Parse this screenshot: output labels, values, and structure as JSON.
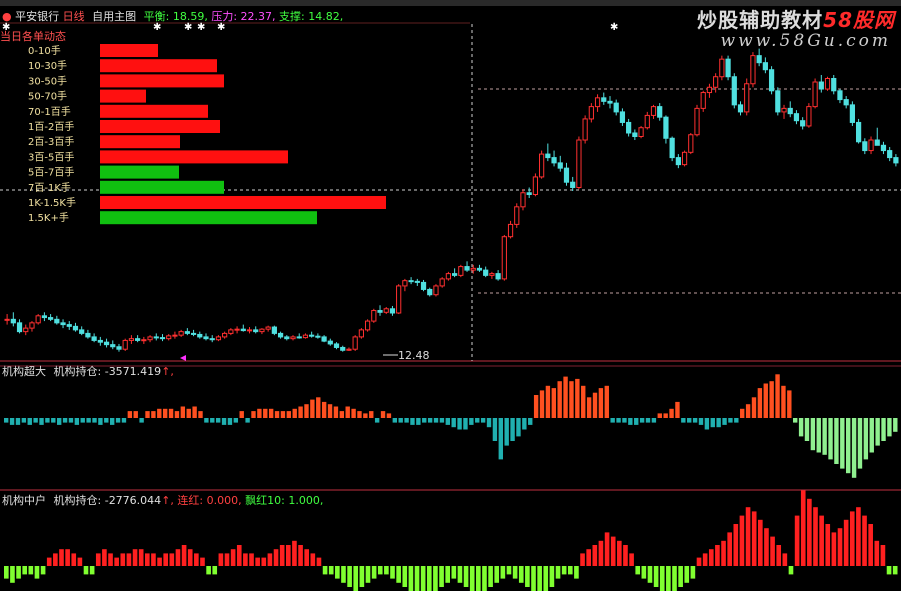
{
  "header": {
    "stock": "平安银行",
    "period": "日线",
    "main_chart": "自用主图",
    "balance_label": "平衡:",
    "balance_value": "18.59,",
    "pressure_label": "压力:",
    "pressure_value": "22.37,",
    "support_label": "支撑:",
    "support_value": "14.82,"
  },
  "watermark": {
    "brand": "炒股辅助教材",
    "brand_accent": "58股网",
    "url": "www.58Gu.com"
  },
  "price_label": "12.48",
  "colors": {
    "up": "#ff3030",
    "down": "#50e0e0",
    "bar_red": "#ff1010",
    "bar_green": "#10c010",
    "indicator_up": "#ff5020",
    "indicator_down": "#20b0b0",
    "indicator_down2": "#90f090",
    "lime": "#80ff30"
  },
  "order_panel": {
    "title": "当日各单动态",
    "rows": [
      {
        "label": "0-10手",
        "value": 58,
        "color": "red"
      },
      {
        "label": "10-30手",
        "value": 117,
        "color": "red"
      },
      {
        "label": "30-50手",
        "value": 124,
        "color": "red"
      },
      {
        "label": "50-70手",
        "value": 46,
        "color": "red"
      },
      {
        "label": "70-1百手",
        "value": 108,
        "color": "red"
      },
      {
        "label": "1百-2百手",
        "value": 120,
        "color": "red"
      },
      {
        "label": "2百-3百手",
        "value": 80,
        "color": "red"
      },
      {
        "label": "3百-5百手",
        "value": 188,
        "color": "red"
      },
      {
        "label": "5百-7百手",
        "value": 79,
        "color": "green"
      },
      {
        "label": "7百-1K手",
        "value": 124,
        "color": "green"
      },
      {
        "label": "1K-1.5K手",
        "value": 286,
        "color": "red"
      },
      {
        "label": "1.5K+手",
        "value": 217,
        "color": "green"
      }
    ]
  },
  "indicator1": {
    "name": "机构超大",
    "field": "机构持仓:",
    "value": "-3571.419",
    "arrow": "↑,"
  },
  "indicator2": {
    "name": "机构中户",
    "field": "机构持仓:",
    "value": "-2776.044",
    "arrow": "↑,",
    "extra1_label": "连红:",
    "extra1_value": "0.000,",
    "extra2_label": "飘红10:",
    "extra2_value": "1.000,"
  },
  "chart_data": {
    "type": "candlestick",
    "candles": [
      [
        13.4,
        13.55,
        13.25,
        13.4
      ],
      [
        13.4,
        13.6,
        13.2,
        13.3
      ],
      [
        13.3,
        13.4,
        13.0,
        13.05
      ],
      [
        13.05,
        13.25,
        12.95,
        13.15
      ],
      [
        13.15,
        13.35,
        13.05,
        13.3
      ],
      [
        13.3,
        13.55,
        13.25,
        13.5
      ],
      [
        13.5,
        13.6,
        13.35,
        13.45
      ],
      [
        13.45,
        13.55,
        13.35,
        13.4
      ],
      [
        13.4,
        13.5,
        13.25,
        13.3
      ],
      [
        13.3,
        13.4,
        13.15,
        13.25
      ],
      [
        13.25,
        13.35,
        13.1,
        13.2
      ],
      [
        13.2,
        13.3,
        13.05,
        13.1
      ],
      [
        13.1,
        13.2,
        12.95,
        13.0
      ],
      [
        13.0,
        13.1,
        12.85,
        12.9
      ],
      [
        12.9,
        13.0,
        12.75,
        12.8
      ],
      [
        12.8,
        12.9,
        12.65,
        12.75
      ],
      [
        12.75,
        12.85,
        12.6,
        12.68
      ],
      [
        12.68,
        12.8,
        12.55,
        12.62
      ],
      [
        12.62,
        12.7,
        12.48,
        12.55
      ],
      [
        12.55,
        12.85,
        12.5,
        12.8
      ],
      [
        12.8,
        12.95,
        12.7,
        12.85
      ],
      [
        12.85,
        12.95,
        12.75,
        12.8
      ],
      [
        12.8,
        12.9,
        12.7,
        12.82
      ],
      [
        12.82,
        12.95,
        12.75,
        12.9
      ],
      [
        12.9,
        13.0,
        12.8,
        12.88
      ],
      [
        12.88,
        12.98,
        12.78,
        12.85
      ],
      [
        12.85,
        12.98,
        12.8,
        12.93
      ],
      [
        12.93,
        13.05,
        12.85,
        12.95
      ],
      [
        12.95,
        13.1,
        12.9,
        13.05
      ],
      [
        13.05,
        13.15,
        12.95,
        13.0
      ],
      [
        13.0,
        13.1,
        12.92,
        12.97
      ],
      [
        12.97,
        13.05,
        12.85,
        12.9
      ],
      [
        12.9,
        13.0,
        12.8,
        12.85
      ],
      [
        12.85,
        12.95,
        12.75,
        12.82
      ],
      [
        12.82,
        12.95,
        12.78,
        12.9
      ],
      [
        12.9,
        13.05,
        12.85,
        13.0
      ],
      [
        13.0,
        13.15,
        12.95,
        13.1
      ],
      [
        13.1,
        13.2,
        13.0,
        13.12
      ],
      [
        13.12,
        13.25,
        13.05,
        13.08
      ],
      [
        13.08,
        13.18,
        13.0,
        13.1
      ],
      [
        13.1,
        13.2,
        13.0,
        13.05
      ],
      [
        13.05,
        13.15,
        12.98,
        13.12
      ],
      [
        13.12,
        13.22,
        13.05,
        13.18
      ],
      [
        13.18,
        13.22,
        12.95,
        13.0
      ],
      [
        13.0,
        13.05,
        12.85,
        12.9
      ],
      [
        12.9,
        12.95,
        12.8,
        12.85
      ],
      [
        12.85,
        12.95,
        12.8,
        12.9
      ],
      [
        12.9,
        13.0,
        12.85,
        12.88
      ],
      [
        12.88,
        13.0,
        12.85,
        12.95
      ],
      [
        12.95,
        13.05,
        12.88,
        12.92
      ],
      [
        12.92,
        13.0,
        12.85,
        12.9
      ],
      [
        12.9,
        12.95,
        12.75,
        12.78
      ],
      [
        12.78,
        12.85,
        12.65,
        12.7
      ],
      [
        12.7,
        12.75,
        12.55,
        12.6
      ],
      [
        12.6,
        12.65,
        12.48,
        12.52
      ],
      [
        12.52,
        12.6,
        12.5,
        12.55
      ],
      [
        12.55,
        12.95,
        12.5,
        12.9
      ],
      [
        12.9,
        13.15,
        12.85,
        13.1
      ],
      [
        13.1,
        13.4,
        13.05,
        13.35
      ],
      [
        13.35,
        13.7,
        13.3,
        13.65
      ],
      [
        13.65,
        13.8,
        13.5,
        13.6
      ],
      [
        13.6,
        13.75,
        13.55,
        13.7
      ],
      [
        13.7,
        13.78,
        13.5,
        13.58
      ],
      [
        13.58,
        14.4,
        13.55,
        14.35
      ],
      [
        14.35,
        14.55,
        14.2,
        14.5
      ],
      [
        14.5,
        14.6,
        14.4,
        14.48
      ],
      [
        14.48,
        14.55,
        14.35,
        14.45
      ],
      [
        14.45,
        14.52,
        14.2,
        14.25
      ],
      [
        14.25,
        14.3,
        14.05,
        14.1
      ],
      [
        14.1,
        14.4,
        14.05,
        14.35
      ],
      [
        14.35,
        14.6,
        14.3,
        14.55
      ],
      [
        14.55,
        14.75,
        14.5,
        14.7
      ],
      [
        14.7,
        14.85,
        14.6,
        14.65
      ],
      [
        14.65,
        14.95,
        14.6,
        14.9
      ],
      [
        14.9,
        15.05,
        14.75,
        14.8
      ],
      [
        14.8,
        14.95,
        14.7,
        14.85
      ],
      [
        14.85,
        14.95,
        14.75,
        14.8
      ],
      [
        14.8,
        14.9,
        14.6,
        14.65
      ],
      [
        14.65,
        14.75,
        14.55,
        14.7
      ],
      [
        14.7,
        14.8,
        14.5,
        14.55
      ],
      [
        14.55,
        15.8,
        14.5,
        15.75
      ],
      [
        15.75,
        16.2,
        15.7,
        16.1
      ],
      [
        16.1,
        16.7,
        16.0,
        16.6
      ],
      [
        16.6,
        17.1,
        16.5,
        17.0
      ],
      [
        17.0,
        17.15,
        16.85,
        16.95
      ],
      [
        16.95,
        17.55,
        16.9,
        17.45
      ],
      [
        17.45,
        18.2,
        17.4,
        18.1
      ],
      [
        18.1,
        18.4,
        17.9,
        18.0
      ],
      [
        18.0,
        18.2,
        17.75,
        17.85
      ],
      [
        17.85,
        18.05,
        17.6,
        17.7
      ],
      [
        17.7,
        17.85,
        17.2,
        17.3
      ],
      [
        17.3,
        17.45,
        17.05,
        17.15
      ],
      [
        17.15,
        18.6,
        17.1,
        18.5
      ],
      [
        18.5,
        19.2,
        18.4,
        19.1
      ],
      [
        19.1,
        19.55,
        19.0,
        19.45
      ],
      [
        19.45,
        19.8,
        19.3,
        19.7
      ],
      [
        19.7,
        19.85,
        19.5,
        19.6
      ],
      [
        19.6,
        19.75,
        19.4,
        19.55
      ],
      [
        19.55,
        19.65,
        19.2,
        19.3
      ],
      [
        19.3,
        19.4,
        18.9,
        19.0
      ],
      [
        19.0,
        19.1,
        18.6,
        18.7
      ],
      [
        18.7,
        18.8,
        18.5,
        18.6
      ],
      [
        18.6,
        18.9,
        18.55,
        18.85
      ],
      [
        18.85,
        19.3,
        18.8,
        19.2
      ],
      [
        19.2,
        19.5,
        19.1,
        19.45
      ],
      [
        19.45,
        19.55,
        19.05,
        19.15
      ],
      [
        19.15,
        19.2,
        18.4,
        18.55
      ],
      [
        18.55,
        18.6,
        17.9,
        18.0
      ],
      [
        18.0,
        18.1,
        17.7,
        17.8
      ],
      [
        17.8,
        18.2,
        17.75,
        18.15
      ],
      [
        18.15,
        18.7,
        18.1,
        18.65
      ],
      [
        18.65,
        19.5,
        18.6,
        19.4
      ],
      [
        19.4,
        19.9,
        19.3,
        19.85
      ],
      [
        19.85,
        20.1,
        19.7,
        20.0
      ],
      [
        20.0,
        20.4,
        19.85,
        20.3
      ],
      [
        20.3,
        20.9,
        20.2,
        20.8
      ],
      [
        20.8,
        20.9,
        20.2,
        20.3
      ],
      [
        20.3,
        20.4,
        19.4,
        19.5
      ],
      [
        19.5,
        19.6,
        19.2,
        19.3
      ],
      [
        19.3,
        20.25,
        19.2,
        20.1
      ],
      [
        20.1,
        21.0,
        20.0,
        20.9
      ],
      [
        20.9,
        21.1,
        20.6,
        20.7
      ],
      [
        20.7,
        20.85,
        20.4,
        20.5
      ],
      [
        20.5,
        20.6,
        19.8,
        19.9
      ],
      [
        19.9,
        20.0,
        19.2,
        19.3
      ],
      [
        19.3,
        19.5,
        19.1,
        19.4
      ],
      [
        19.4,
        19.6,
        19.15,
        19.25
      ],
      [
        19.25,
        19.35,
        18.95,
        19.05
      ],
      [
        19.05,
        19.15,
        18.8,
        18.9
      ],
      [
        18.9,
        19.55,
        18.85,
        19.45
      ],
      [
        19.45,
        20.25,
        19.4,
        20.15
      ],
      [
        20.15,
        20.35,
        19.85,
        19.95
      ],
      [
        19.95,
        20.3,
        19.9,
        20.25
      ],
      [
        20.25,
        20.35,
        19.8,
        19.9
      ],
      [
        19.9,
        19.95,
        19.55,
        19.65
      ],
      [
        19.65,
        19.75,
        19.4,
        19.5
      ],
      [
        19.5,
        19.6,
        18.9,
        19.0
      ],
      [
        19.0,
        19.1,
        18.4,
        18.45
      ],
      [
        18.45,
        18.55,
        18.1,
        18.2
      ],
      [
        18.2,
        18.6,
        18.1,
        18.5
      ],
      [
        18.5,
        18.85,
        18.45,
        18.35
      ],
      [
        18.35,
        18.45,
        18.1,
        18.2
      ],
      [
        18.2,
        18.3,
        17.9,
        18.0
      ],
      [
        18.0,
        18.1,
        17.75,
        17.85
      ]
    ],
    "ylim": [
      12.3,
      21.8
    ],
    "ticks": {
      "balance": 18.59,
      "pressure": 22.37,
      "support": 14.82
    },
    "indicator1_values": [
      -2,
      -3,
      -3,
      -2,
      -3,
      -2,
      -3,
      -2,
      -2,
      -3,
      -2,
      -2,
      -3,
      -2,
      -2,
      -2,
      -3,
      -2,
      -3,
      -2,
      -2,
      3,
      3,
      -2,
      3,
      3,
      4,
      4,
      4,
      3,
      5,
      4,
      5,
      3,
      -2,
      -2,
      -2,
      -3,
      -3,
      -2,
      3,
      -2,
      3,
      4,
      4,
      4,
      3,
      3,
      3,
      4,
      5,
      6,
      8,
      9,
      7,
      6,
      5,
      3,
      5,
      4,
      3,
      2,
      3,
      -2,
      3,
      2,
      -2,
      -2,
      -2,
      -3,
      -3,
      -2,
      -2,
      -2,
      -2,
      -3,
      -4,
      -5,
      -5,
      -3,
      -2,
      -2,
      -4,
      -10,
      -18,
      -12,
      -10,
      -8,
      -5,
      -3,
      10,
      12,
      14,
      13,
      16,
      18,
      16,
      17,
      14,
      9,
      11,
      13,
      14,
      -2,
      -2,
      -2,
      -3,
      -3,
      -2,
      -2,
      -2,
      2,
      2,
      4,
      7,
      -2,
      -2,
      -2,
      -3,
      -5,
      -4,
      -4,
      -3,
      -2,
      -2,
      4,
      6,
      9,
      13,
      15,
      16,
      19,
      14,
      12,
      -2,
      -8,
      -10,
      -14,
      -15,
      -16,
      -18,
      -20,
      -22,
      -24,
      -26,
      -22,
      -18,
      -15,
      -12,
      -10,
      -8,
      -6
    ],
    "indicator2_values": [
      -3,
      -4,
      -3,
      -2,
      -2,
      -3,
      -2,
      2,
      3,
      4,
      4,
      3,
      2,
      -2,
      -2,
      3,
      4,
      3,
      2,
      3,
      3,
      4,
      4,
      3,
      3,
      2,
      3,
      3,
      4,
      5,
      4,
      3,
      2,
      -2,
      -2,
      3,
      3,
      4,
      5,
      3,
      3,
      2,
      2,
      3,
      4,
      5,
      5,
      6,
      5,
      4,
      3,
      2,
      -2,
      -2,
      -3,
      -4,
      -5,
      -6,
      -5,
      -4,
      -3,
      -2,
      -2,
      -3,
      -4,
      -5,
      -6,
      -7,
      -8,
      -7,
      -6,
      -5,
      -4,
      -3,
      -4,
      -5,
      -6,
      -7,
      -6,
      -5,
      -4,
      -3,
      -2,
      -3,
      -4,
      -5,
      -6,
      -7,
      -6,
      -5,
      -3,
      -2,
      -2,
      -3,
      3,
      4,
      5,
      6,
      8,
      7,
      6,
      5,
      3,
      -2,
      -3,
      -4,
      -5,
      -6,
      -7,
      -6,
      -5,
      -4,
      -3,
      2,
      3,
      4,
      5,
      6,
      8,
      10,
      12,
      14,
      13,
      11,
      9,
      7,
      5,
      3,
      -2,
      12,
      18,
      16,
      14,
      12,
      10,
      8,
      9,
      11,
      13,
      14,
      12,
      10,
      6,
      5,
      -2,
      -2
    ]
  }
}
